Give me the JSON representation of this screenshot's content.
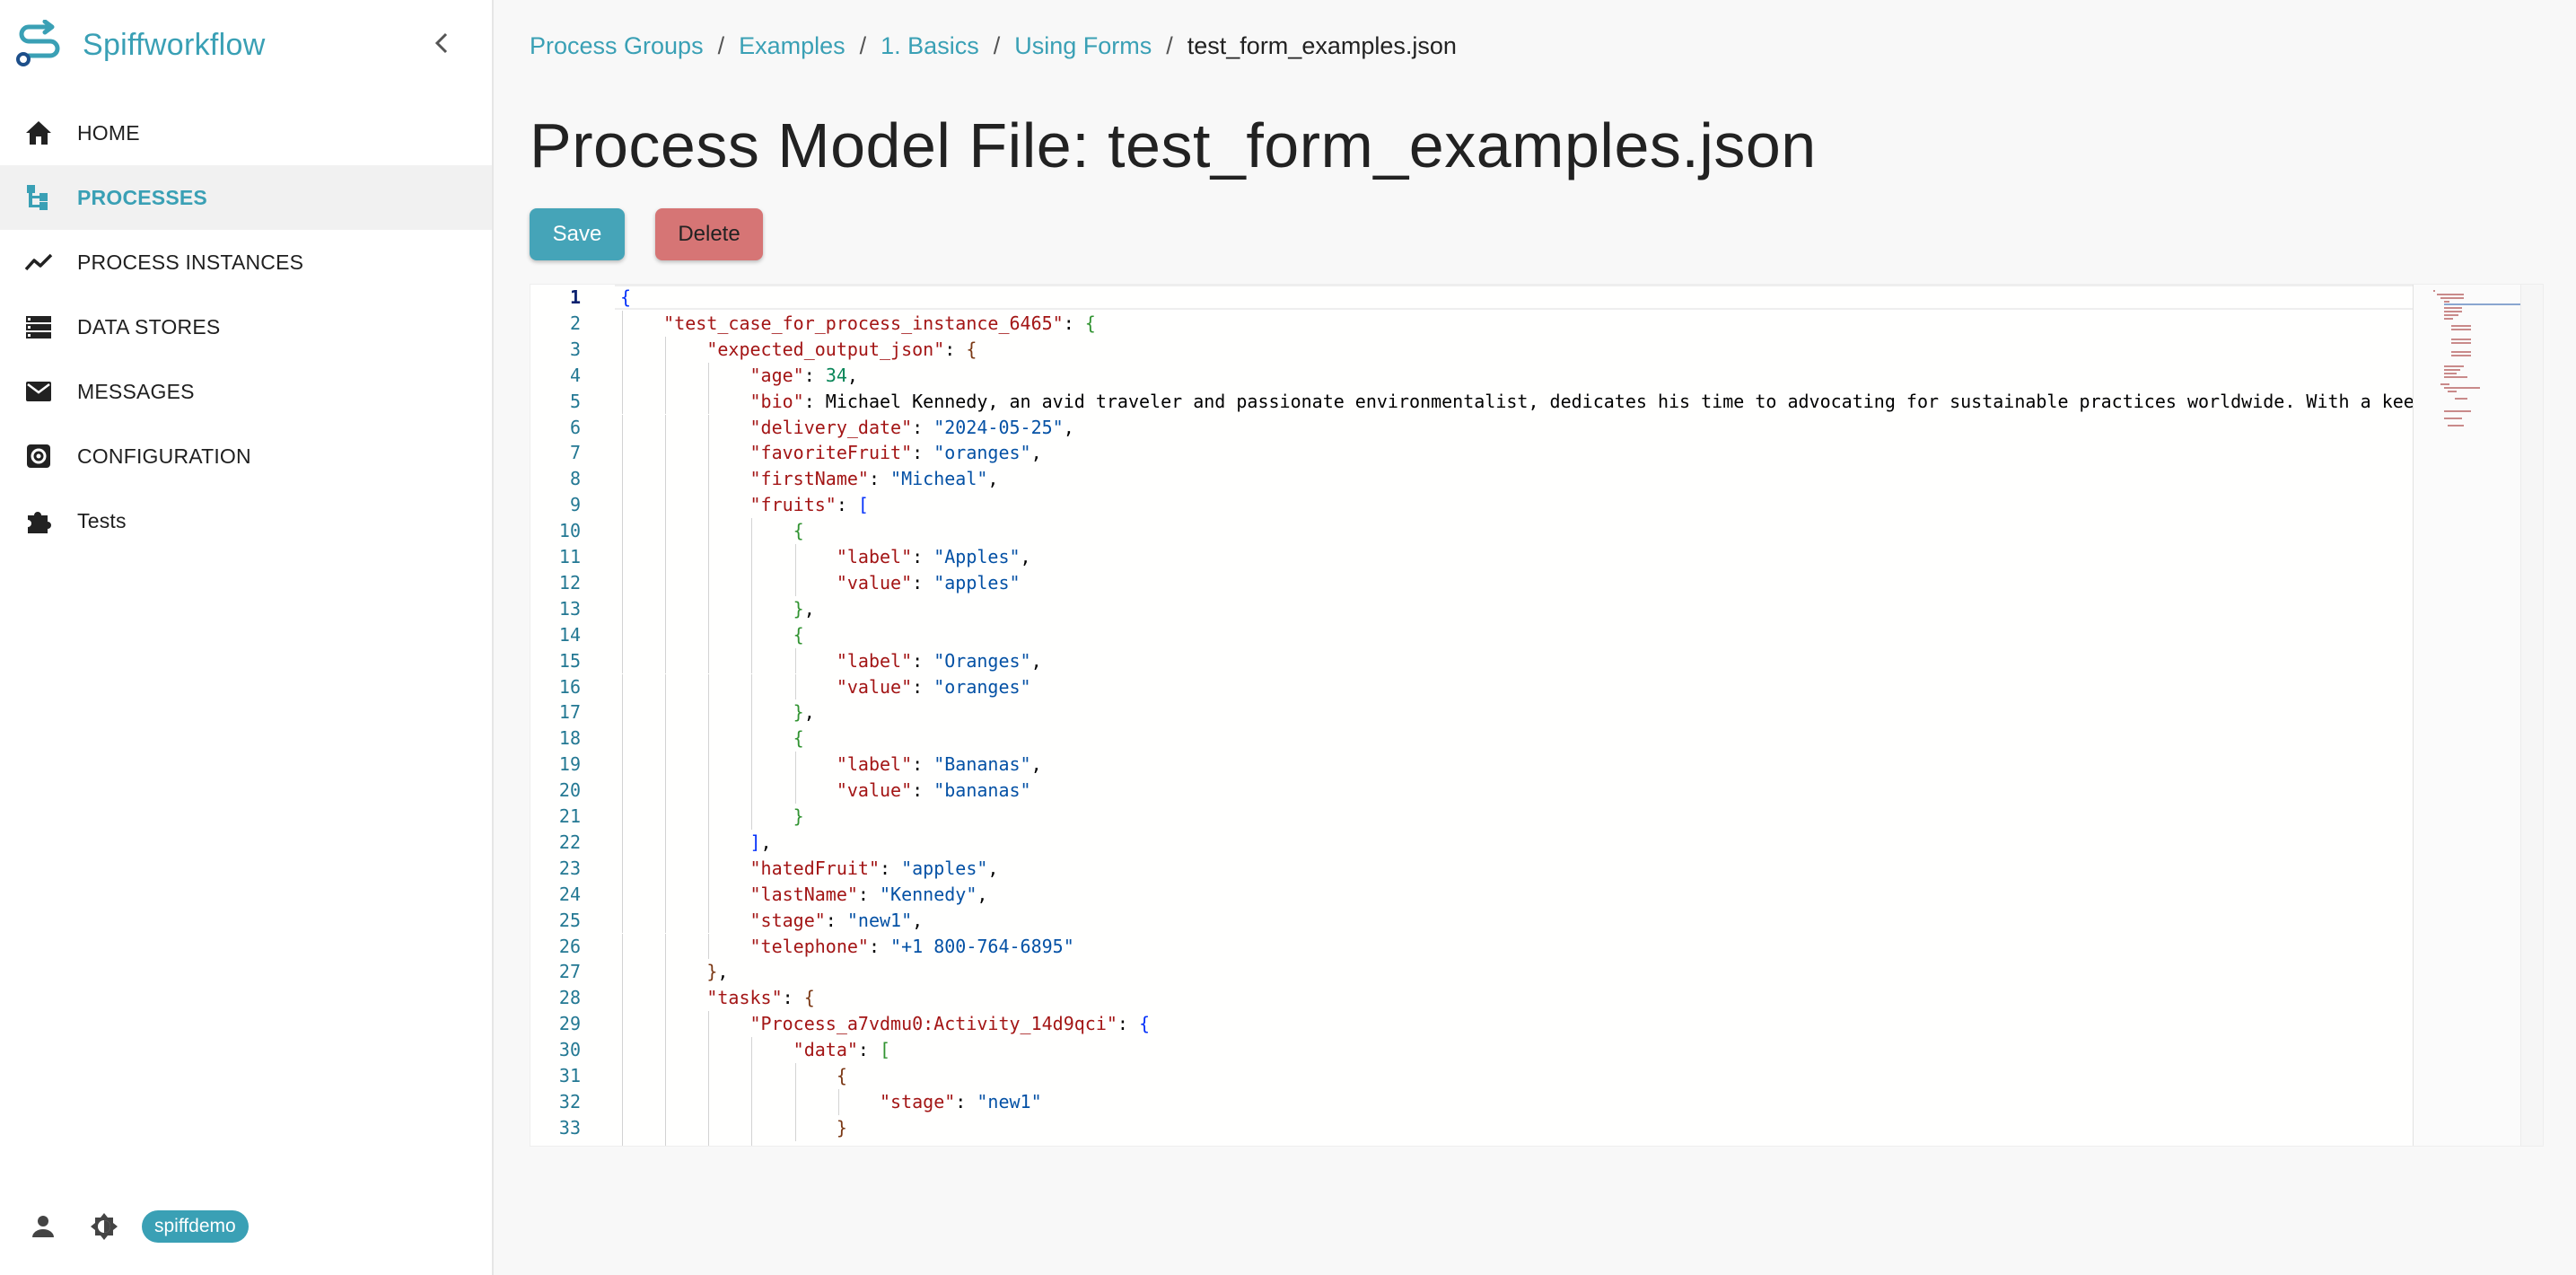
{
  "app": {
    "name": "Spiffworkflow"
  },
  "sidebar": {
    "items": [
      {
        "label": "HOME",
        "icon": "home-icon"
      },
      {
        "label": "PROCESSES",
        "icon": "process-tree-icon",
        "active": true
      },
      {
        "label": "PROCESS INSTANCES",
        "icon": "trend-line-icon"
      },
      {
        "label": "DATA STORES",
        "icon": "storage-icon"
      },
      {
        "label": "MESSAGES",
        "icon": "mail-icon"
      },
      {
        "label": "CONFIGURATION",
        "icon": "gear-icon"
      },
      {
        "label": "Tests",
        "icon": "puzzle-icon"
      }
    ],
    "user": "spiffdemo"
  },
  "breadcrumb": {
    "items": [
      "Process Groups",
      "Examples",
      "1. Basics",
      "Using Forms"
    ],
    "current": "test_form_examples.json"
  },
  "page": {
    "title": "Process Model File: test_form_examples.json"
  },
  "actions": {
    "save_label": "Save",
    "delete_label": "Delete"
  },
  "colors": {
    "accent": "#3aa0b5",
    "save": "#45a4b8",
    "delete": "#d67575",
    "json_key": "#a31515",
    "json_string": "#0451a5",
    "json_number": "#098658"
  },
  "editor": {
    "current_line": 1,
    "lines": [
      "{",
      "    \"test_case_for_process_instance_6465\": {",
      "        \"expected_output_json\": {",
      "            \"age\": 34,",
      "            \"bio\": \"Michael Kennedy, an avid traveler and passionate environmentalist, dedicates his time to advocating for sustainable practices worldwide. With a keen eye",
      "            \"delivery_date\": \"2024-05-25\",",
      "            \"favoriteFruit\": \"oranges\",",
      "            \"firstName\": \"Micheal\",",
      "            \"fruits\": [",
      "                {",
      "                    \"label\": \"Apples\",",
      "                    \"value\": \"apples\"",
      "                },",
      "                {",
      "                    \"label\": \"Oranges\",",
      "                    \"value\": \"oranges\"",
      "                },",
      "                {",
      "                    \"label\": \"Bananas\",",
      "                    \"value\": \"bananas\"",
      "                }",
      "            ],",
      "            \"hatedFruit\": \"apples\",",
      "            \"lastName\": \"Kennedy\",",
      "            \"stage\": \"new1\",",
      "            \"telephone\": \"+1 800-764-6895\"",
      "        },",
      "        \"tasks\": {",
      "            \"Process_a7vdmu0:Activity_14d9qci\": {",
      "                \"data\": [",
      "                    {",
      "                        \"stage\": \"new1\"",
      "                    }",
      "                ]"
    ]
  }
}
